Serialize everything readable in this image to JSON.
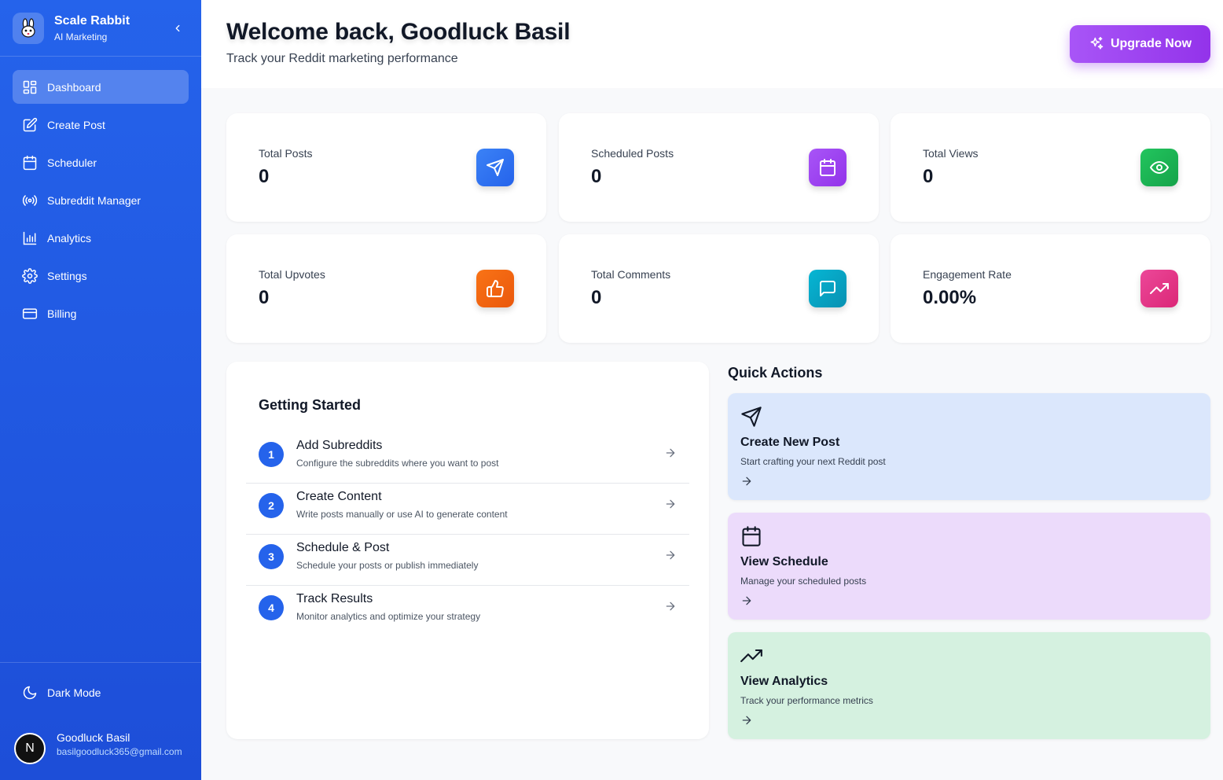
{
  "brand": {
    "title": "Scale Rabbit",
    "subtitle": "AI Marketing",
    "logo_icon": "rabbit-icon"
  },
  "sidebar": {
    "items": [
      {
        "label": "Dashboard",
        "icon": "dashboard-icon",
        "active": true
      },
      {
        "label": "Create Post",
        "icon": "edit-icon"
      },
      {
        "label": "Scheduler",
        "icon": "calendar-icon"
      },
      {
        "label": "Subreddit Manager",
        "icon": "radio-icon"
      },
      {
        "label": "Analytics",
        "icon": "bar-chart-icon"
      },
      {
        "label": "Settings",
        "icon": "gear-icon"
      },
      {
        "label": "Billing",
        "icon": "credit-card-icon"
      }
    ],
    "dark_mode_label": "Dark Mode",
    "user": {
      "name": "Goodluck Basil",
      "email": "basilgoodluck365@gmail.com",
      "avatar_letter": "N"
    }
  },
  "header": {
    "title": "Welcome back, Goodluck Basil",
    "subtitle": "Track your Reddit marketing performance",
    "upgrade_label": "Upgrade Now"
  },
  "stats": [
    {
      "label": "Total Posts",
      "value": "0",
      "icon": "send-icon",
      "color": "#2563eb"
    },
    {
      "label": "Scheduled Posts",
      "value": "0",
      "icon": "calendar-icon",
      "color": "#9333ea"
    },
    {
      "label": "Total Views",
      "value": "0",
      "icon": "eye-icon",
      "color": "#16a34a"
    },
    {
      "label": "Total Upvotes",
      "value": "0",
      "icon": "thumbs-up-icon",
      "color": "#ea580c"
    },
    {
      "label": "Total Comments",
      "value": "0",
      "icon": "comment-icon",
      "color": "#0891b2"
    },
    {
      "label": "Engagement Rate",
      "value": "0.00%",
      "icon": "trending-up-icon",
      "color": "#db2777"
    }
  ],
  "getting_started": {
    "title": "Getting Started",
    "steps": [
      {
        "num": "1",
        "name": "Add Subreddits",
        "desc": "Configure the subreddits where you want to post"
      },
      {
        "num": "2",
        "name": "Create Content",
        "desc": "Write posts manually or use AI to generate content"
      },
      {
        "num": "3",
        "name": "Schedule & Post",
        "desc": "Schedule your posts or publish immediately"
      },
      {
        "num": "4",
        "name": "Track Results",
        "desc": "Monitor analytics and optimize your strategy"
      }
    ]
  },
  "quick_actions": {
    "title": "Quick Actions",
    "items": [
      {
        "name": "Create New Post",
        "desc": "Start crafting your next Reddit post",
        "icon": "send-icon",
        "bg": "#dbe7fc"
      },
      {
        "name": "View Schedule",
        "desc": "Manage your scheduled posts",
        "icon": "calendar-icon",
        "bg": "#ecdbfb"
      },
      {
        "name": "View Analytics",
        "desc": "Track your performance metrics",
        "icon": "trending-up-icon",
        "bg": "#d5f1e0"
      }
    ]
  }
}
